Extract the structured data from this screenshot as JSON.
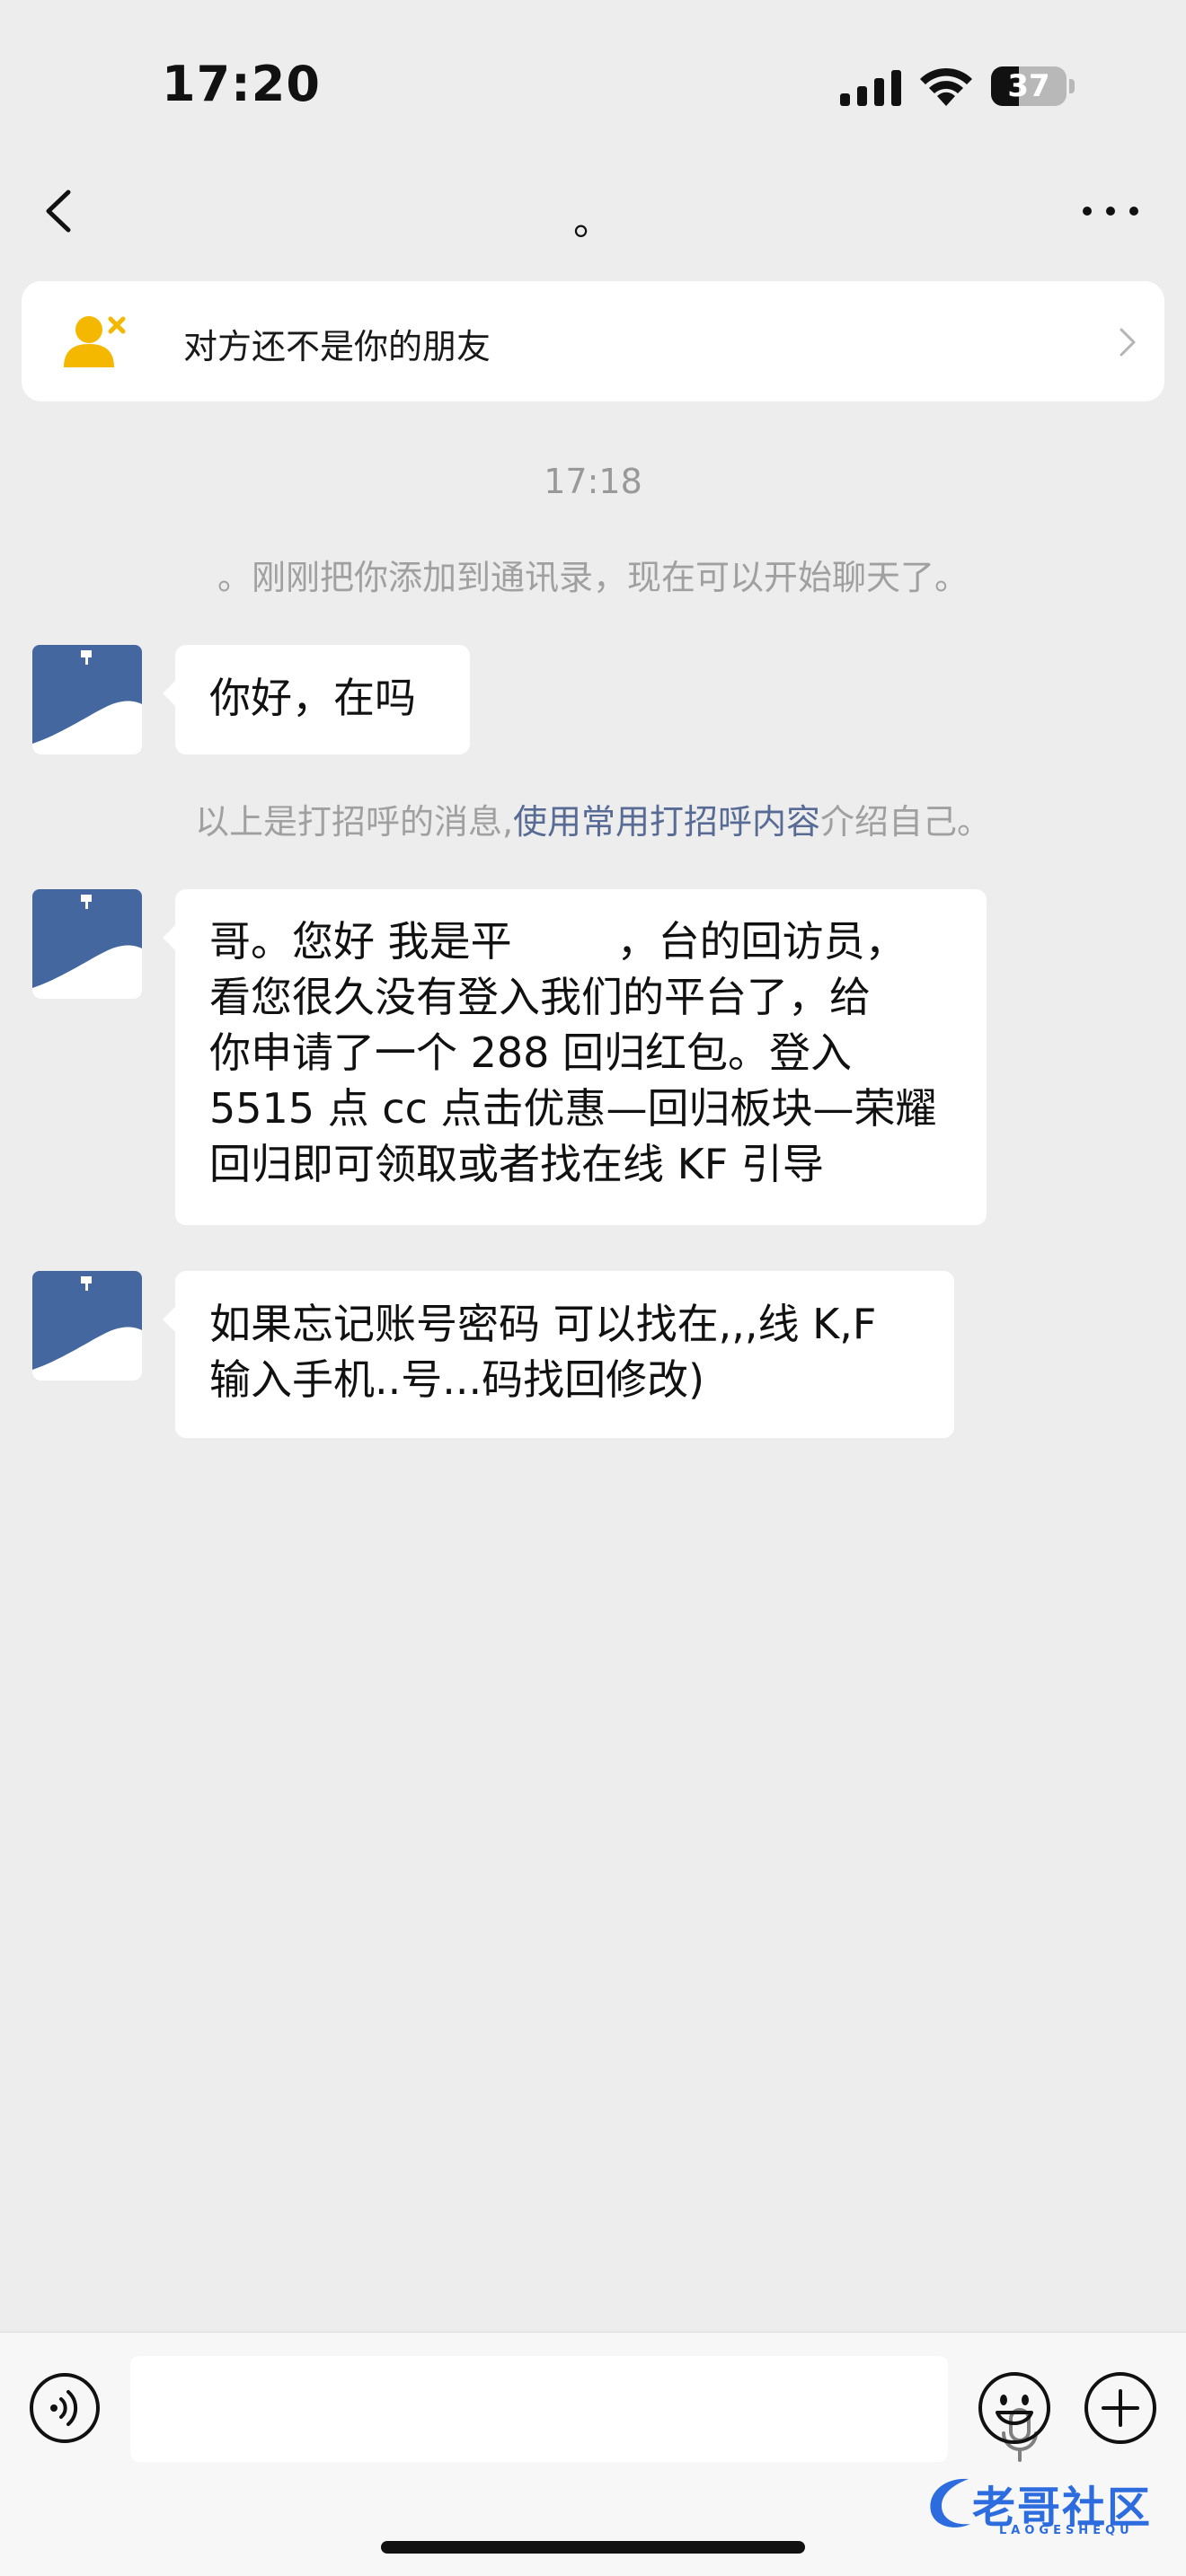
{
  "status_bar": {
    "time": "17:20",
    "battery_level": "37",
    "battery_fraction": 0.37
  },
  "nav": {
    "title": "。",
    "back_icon": "chevron-left-icon",
    "more_icon": "ellipsis-icon"
  },
  "stranger_banner": {
    "text": "对方还不是你的朋友",
    "icon": "person-remove-icon",
    "icon_color": "#f5b800"
  },
  "chat": {
    "timestamp": "17:18",
    "system_added": "。刚刚把你添加到通讯录，现在可以开始聊天了。",
    "greeting_hint_prefix": "以上是打招呼的消息,",
    "greeting_hint_link": "使用常用打招呼内容",
    "greeting_hint_suffix": "介绍自己。",
    "messages": [
      {
        "lines": [
          "你好，在吗"
        ]
      },
      {
        "lines": [
          "哥。您好 我是平        ，台的回访员，",
          "看您很久没有登入我们的平台了，给",
          "你申请了一个 288 回归红包。登入",
          "5515 点 cc 点击优惠—回归板块—荣耀",
          "回归即可领取或者找在线 KF 引导"
        ]
      },
      {
        "lines": [
          "如果忘记账号密码 可以找在,,,线 K,F",
          "输入手机..号...码找回修改)"
        ]
      }
    ]
  },
  "input_bar": {
    "voice_icon": "voice-icon",
    "mic_icon": "microphone-icon",
    "emoji_icon": "emoji-icon",
    "plus_icon": "plus-icon"
  },
  "watermark": {
    "text": "老哥社区",
    "sub": "LAOGESHEQU"
  },
  "colors": {
    "background": "#ededed",
    "link": "#576b95",
    "avatar": "#4567a0"
  }
}
